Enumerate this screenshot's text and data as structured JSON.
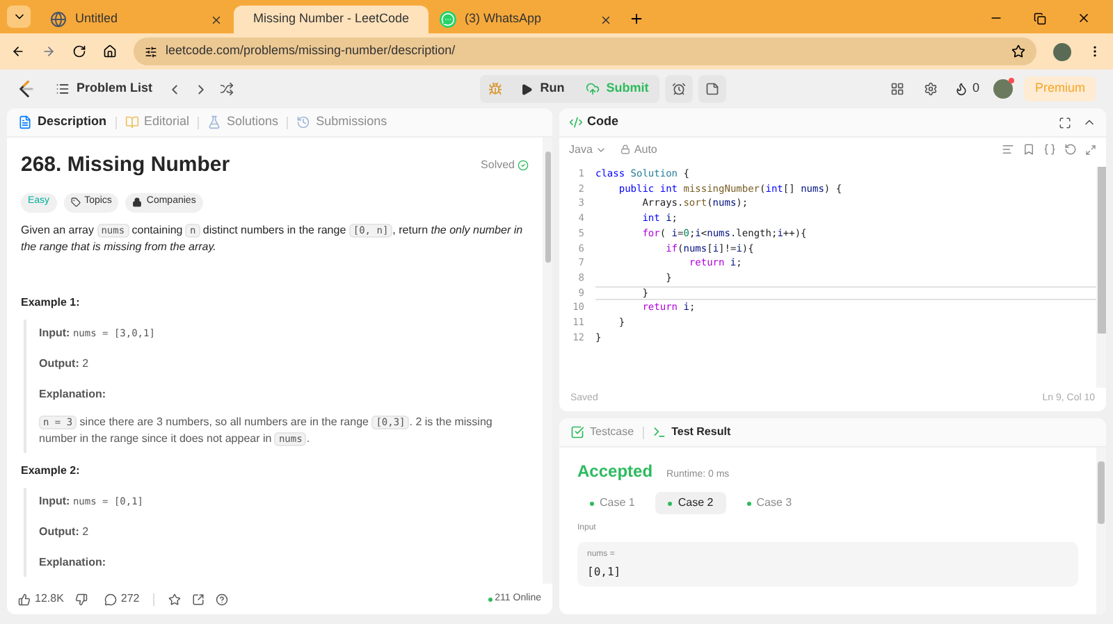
{
  "browser": {
    "tabs": [
      {
        "title": "Untitled",
        "selected": false
      },
      {
        "title": "Missing Number - LeetCode",
        "selected": true
      },
      {
        "title": "(3) WhatsApp",
        "selected": false
      }
    ],
    "url": "leetcode.com/problems/missing-number/description/"
  },
  "nav": {
    "problem_list": "Problem List",
    "run": "Run",
    "submit": "Submit",
    "streak": "0",
    "premium": "Premium"
  },
  "description_panel": {
    "tabs": [
      {
        "label": "Description",
        "selected": true
      },
      {
        "label": "Editorial",
        "selected": false
      },
      {
        "label": "Solutions",
        "selected": false
      },
      {
        "label": "Submissions",
        "selected": false
      }
    ],
    "title": "268. Missing Number",
    "status": "Solved",
    "tags": [
      {
        "label": "Easy",
        "kind": "difficulty"
      },
      {
        "label": "Topics",
        "kind": "topics"
      },
      {
        "label": "Companies",
        "kind": "companies"
      }
    ],
    "statement": [
      {
        "kind": "text",
        "text": "Given an array "
      },
      {
        "kind": "code",
        "text": "nums"
      },
      {
        "kind": "text",
        "text": " containing "
      },
      {
        "kind": "code",
        "text": "n"
      },
      {
        "kind": "text",
        "text": " distinct numbers in the range "
      },
      {
        "kind": "code",
        "text": "[0, n]"
      },
      {
        "kind": "text",
        "text": ", return "
      },
      {
        "kind": "italic",
        "text": "the only number in the range that is missing from the array."
      }
    ],
    "examples": [
      {
        "title": "Example 1:",
        "input_label": "Input:",
        "input": "nums = [3,0,1]",
        "output_label": "Output:",
        "output": "2",
        "explanation_label": "Explanation:",
        "explanation": [
          {
            "kind": "code",
            "text": "n = 3"
          },
          {
            "kind": "text",
            "text": " since there are 3 numbers, so all numbers are in the range "
          },
          {
            "kind": "code",
            "text": "[0,3]"
          },
          {
            "kind": "text",
            "text": ". 2 is the missing number in the range since it does not appear in "
          },
          {
            "kind": "code",
            "text": "nums"
          },
          {
            "kind": "text",
            "text": "."
          }
        ]
      },
      {
        "title": "Example 2:",
        "input_label": "Input:",
        "input": "nums = [0,1]",
        "output_label": "Output:",
        "output": "2",
        "explanation_label": "Explanation:"
      }
    ],
    "footer": {
      "likes": "12.8K",
      "comments": "272",
      "online": "211 Online"
    }
  },
  "code_panel": {
    "title": "Code",
    "language": "Java",
    "mode": "Auto",
    "lines": [
      {
        "number": "1",
        "current": false,
        "tokens": [
          {
            "kind": "kw",
            "text": "class"
          },
          {
            "kind": "type",
            "text": " Solution"
          },
          {
            "kind": "plain",
            "text": " {"
          }
        ]
      },
      {
        "number": "2",
        "current": false,
        "tokens": [
          {
            "kind": "kw",
            "text": "    public"
          },
          {
            "kind": "kw",
            "text": " int"
          },
          {
            "kind": "fn",
            "text": " missingNumber"
          },
          {
            "kind": "plain",
            "text": "("
          },
          {
            "kind": "kw",
            "text": "int"
          },
          {
            "kind": "plain",
            "text": "[] "
          },
          {
            "kind": "var",
            "text": "nums"
          },
          {
            "kind": "plain",
            "text": ") {"
          }
        ]
      },
      {
        "number": "3",
        "current": false,
        "tokens": [
          {
            "kind": "plain",
            "text": "        Arrays."
          },
          {
            "kind": "fn",
            "text": "sort"
          },
          {
            "kind": "plain",
            "text": "("
          },
          {
            "kind": "var",
            "text": "nums"
          },
          {
            "kind": "plain",
            "text": ");"
          }
        ]
      },
      {
        "number": "4",
        "current": false,
        "tokens": [
          {
            "kind": "kw",
            "text": "        int"
          },
          {
            "kind": "var",
            "text": " i"
          },
          {
            "kind": "plain",
            "text": ";"
          }
        ]
      },
      {
        "number": "5",
        "current": false,
        "tokens": [
          {
            "kind": "ctrl",
            "text": "        for"
          },
          {
            "kind": "plain",
            "text": "( "
          },
          {
            "kind": "var",
            "text": "i"
          },
          {
            "kind": "plain",
            "text": "="
          },
          {
            "kind": "num",
            "text": "0"
          },
          {
            "kind": "plain",
            "text": ";"
          },
          {
            "kind": "var",
            "text": "i"
          },
          {
            "kind": "plain",
            "text": "<"
          },
          {
            "kind": "var",
            "text": "nums"
          },
          {
            "kind": "plain",
            "text": ".length;"
          },
          {
            "kind": "var",
            "text": "i"
          },
          {
            "kind": "plain",
            "text": "++){"
          }
        ]
      },
      {
        "number": "6",
        "current": false,
        "tokens": [
          {
            "kind": "ctrl",
            "text": "            if"
          },
          {
            "kind": "plain",
            "text": "("
          },
          {
            "kind": "var",
            "text": "nums"
          },
          {
            "kind": "plain",
            "text": "["
          },
          {
            "kind": "var",
            "text": "i"
          },
          {
            "kind": "plain",
            "text": "]!="
          },
          {
            "kind": "var",
            "text": "i"
          },
          {
            "kind": "plain",
            "text": "){"
          }
        ]
      },
      {
        "number": "7",
        "current": false,
        "tokens": [
          {
            "kind": "ctrl",
            "text": "                return"
          },
          {
            "kind": "var",
            "text": " i"
          },
          {
            "kind": "plain",
            "text": ";"
          }
        ]
      },
      {
        "number": "8",
        "current": false,
        "tokens": [
          {
            "kind": "plain",
            "text": "            }"
          }
        ]
      },
      {
        "number": "9",
        "current": true,
        "tokens": [
          {
            "kind": "plain",
            "text": "        }"
          }
        ]
      },
      {
        "number": "10",
        "current": false,
        "tokens": [
          {
            "kind": "ctrl",
            "text": "        return"
          },
          {
            "kind": "var",
            "text": " i"
          },
          {
            "kind": "plain",
            "text": ";"
          }
        ]
      },
      {
        "number": "11",
        "current": false,
        "tokens": [
          {
            "kind": "plain",
            "text": "    }"
          }
        ]
      },
      {
        "number": "12",
        "current": false,
        "tokens": [
          {
            "kind": "plain",
            "text": "}"
          }
        ]
      }
    ],
    "saved": "Saved",
    "cursor": "Ln 9, Col 10"
  },
  "result_panel": {
    "tabs": [
      {
        "label": "Testcase",
        "selected": false
      },
      {
        "label": "Test Result",
        "selected": true
      }
    ],
    "verdict": "Accepted",
    "runtime": "Runtime: 0 ms",
    "cases": [
      {
        "label": "Case 1",
        "selected": false
      },
      {
        "label": "Case 2",
        "selected": true
      },
      {
        "label": "Case 3",
        "selected": false
      }
    ],
    "input_label": "Input",
    "var_name": "nums =",
    "var_value": "[0,1]"
  }
}
